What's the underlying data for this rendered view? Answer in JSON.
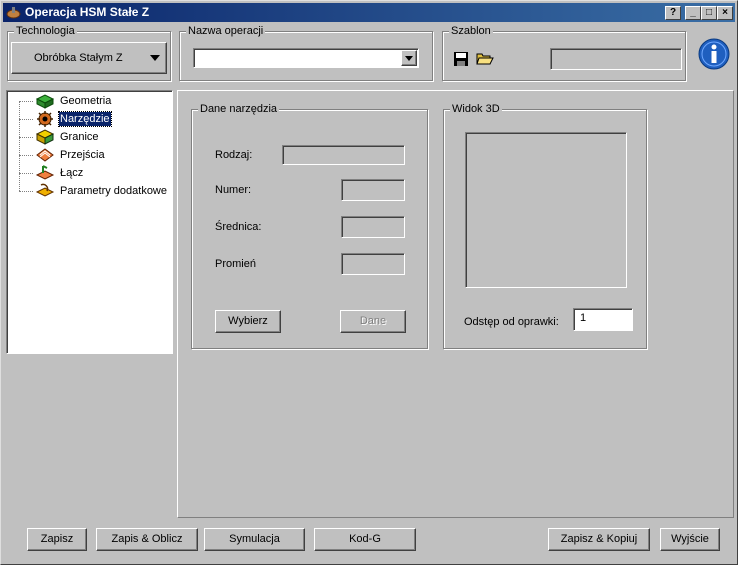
{
  "window": {
    "title": "Operacja HSM Stałe Z",
    "help_btn": "?",
    "min_btn": "_",
    "max_btn": "□",
    "close_btn": "×"
  },
  "technologia": {
    "legend": "Technologia",
    "value": "Obróbka Stałym Z"
  },
  "nazwa_operacji": {
    "legend": "Nazwa operacji",
    "value": ""
  },
  "szablon": {
    "legend": "Szablon",
    "value": ""
  },
  "tree": {
    "items": [
      {
        "label": "Geometria",
        "icon": "geometry-icon",
        "color": "#2e8b2e"
      },
      {
        "label": "Narzędzie",
        "icon": "tool-icon",
        "color": "#d2691e"
      },
      {
        "label": "Granice",
        "icon": "boundary-icon",
        "color": "#c8b400"
      },
      {
        "label": "Przejścia",
        "icon": "passes-icon",
        "color": "#e07030"
      },
      {
        "label": "Łącz",
        "icon": "links-icon",
        "color": "#e07030"
      },
      {
        "label": "Parametry dodatkowe",
        "icon": "extra-params-icon",
        "color": "#e0a000"
      }
    ],
    "selected_index": 1
  },
  "dane_narzedzia": {
    "legend": "Dane narzędzia",
    "rodzaj_label": "Rodzaj:",
    "numer_label": "Numer:",
    "srednica_label": "Średnica:",
    "promien_label": "Promień",
    "rodzaj_value": "",
    "numer_value": "",
    "srednica_value": "",
    "promien_value": "",
    "wybierz": "Wybierz",
    "dane": "Dane"
  },
  "widok3d": {
    "legend": "Widok 3D",
    "odstep_label": "Odstęp od oprawki:",
    "odstep_value": "1"
  },
  "buttons": {
    "zapisz": "Zapisz",
    "zapis_oblicz": "Zapis & Oblicz",
    "symulacja": "Symulacja",
    "kod_g": "Kod-G",
    "zapisz_kopiuj": "Zapisz & Kopiuj",
    "wyjscie": "Wyjście"
  },
  "colors": {
    "titlebar": "#0a246a",
    "face": "#c0c0c0",
    "selection": "#0a246a",
    "info": "#1f5fbf"
  }
}
